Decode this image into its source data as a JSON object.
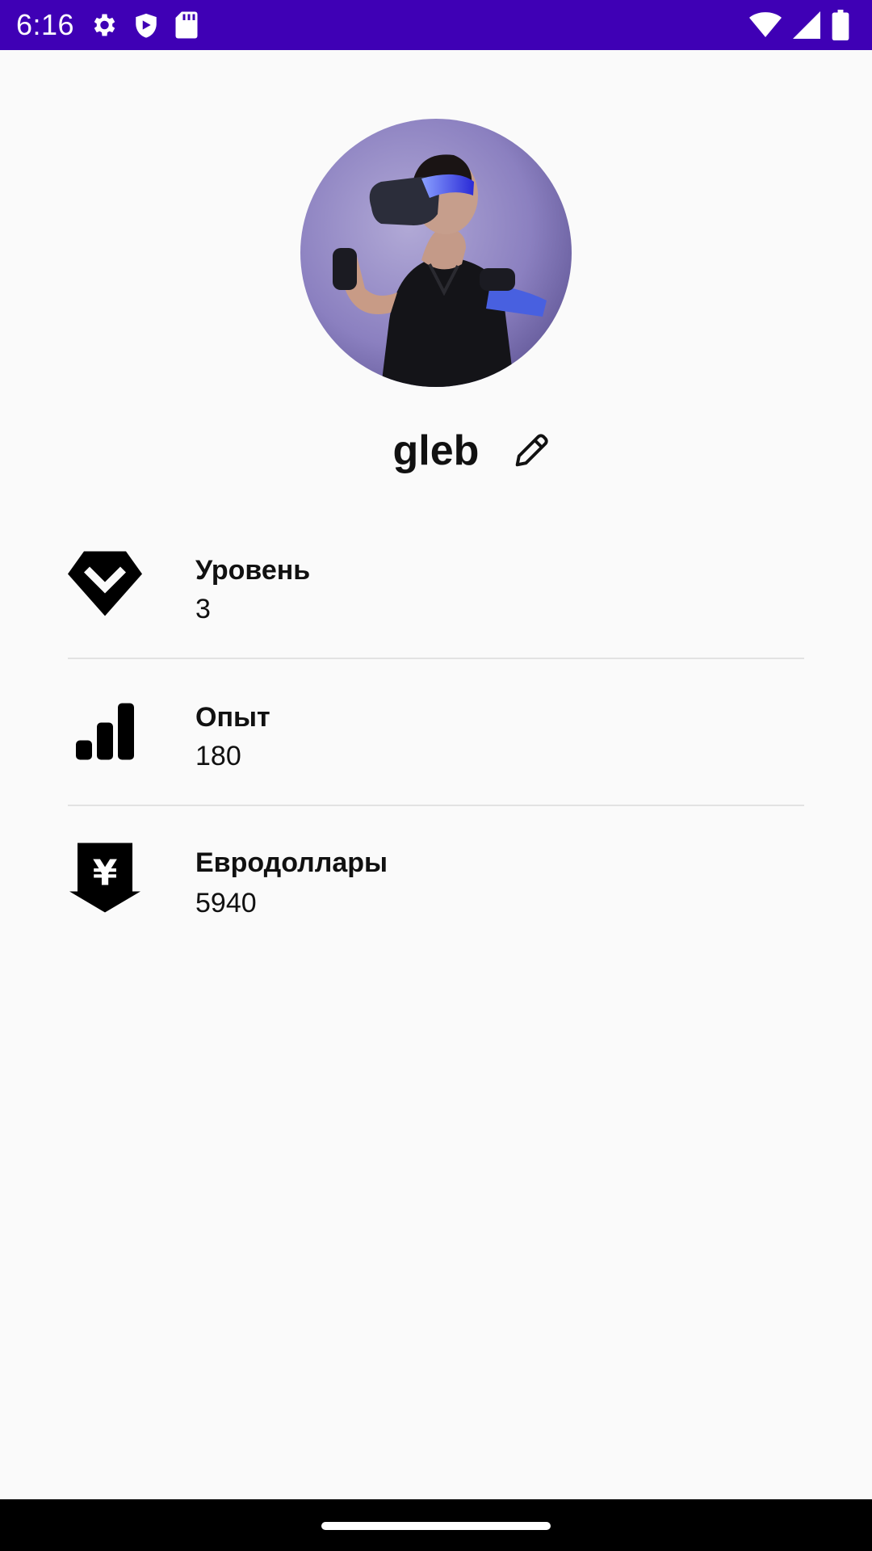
{
  "status_bar": {
    "time": "6:16",
    "background": "#3f00b5",
    "icons_left": [
      "gear-icon",
      "shield-icon",
      "sd-card-icon"
    ],
    "icons_right": [
      "wifi-icon",
      "cell-signal-icon",
      "battery-icon"
    ]
  },
  "profile": {
    "avatar": "vr-headset-photo",
    "name": "gleb",
    "edit_icon": "pencil-icon"
  },
  "stats": [
    {
      "icon": "level-chevron-icon",
      "label": "Уровень",
      "value": "3"
    },
    {
      "icon": "bar-chart-icon",
      "label": "Опыт",
      "value": "180"
    },
    {
      "icon": "yen-icon",
      "label": "Евродоллары",
      "value": "5940"
    }
  ]
}
